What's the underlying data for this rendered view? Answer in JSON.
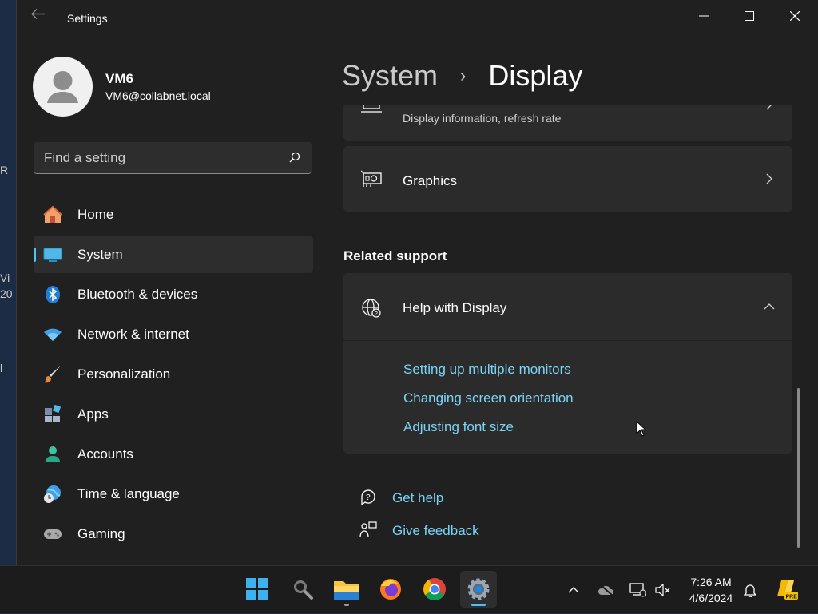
{
  "desktop_fragments": [
    "R",
    "Vi",
    "20",
    "l"
  ],
  "window": {
    "title": "Settings",
    "controls": [
      "minimize-icon",
      "maximize-icon",
      "close-icon"
    ]
  },
  "user": {
    "name": "VM6",
    "email": "VM6@collabnet.local"
  },
  "search": {
    "placeholder": "Find a setting"
  },
  "sidebar": {
    "items": [
      {
        "label": "Home",
        "icon": "home-icon"
      },
      {
        "label": "System",
        "icon": "system-icon",
        "active": true
      },
      {
        "label": "Bluetooth & devices",
        "icon": "bluetooth-icon"
      },
      {
        "label": "Network & internet",
        "icon": "wifi-icon"
      },
      {
        "label": "Personalization",
        "icon": "brush-icon"
      },
      {
        "label": "Apps",
        "icon": "apps-icon"
      },
      {
        "label": "Accounts",
        "icon": "accounts-icon"
      },
      {
        "label": "Time & language",
        "icon": "globe-clock-icon"
      },
      {
        "label": "Gaming",
        "icon": "gamepad-icon"
      }
    ]
  },
  "breadcrumb": {
    "parent": "System",
    "separator": "›",
    "current": "Display"
  },
  "main": {
    "advanced_display": {
      "subtitle": "Display information, refresh rate"
    },
    "graphics": {
      "title": "Graphics"
    },
    "related_support_title": "Related support",
    "help_card": {
      "title": "Help with Display",
      "links": [
        "Setting up multiple monitors",
        "Changing screen orientation",
        "Adjusting font size"
      ]
    },
    "get_help": "Get help",
    "give_feedback": "Give feedback"
  },
  "taskbar": {
    "apps": [
      "start-icon",
      "search-icon",
      "file-explorer-icon",
      "firefox-icon",
      "chrome-icon",
      "settings-icon"
    ],
    "time": "7:26 AM",
    "date": "4/6/2024"
  },
  "colors": {
    "accent": "#4cc2ff",
    "link": "#7cd4f5",
    "window_bg": "#202020",
    "card_bg": "#2b2b2b"
  }
}
